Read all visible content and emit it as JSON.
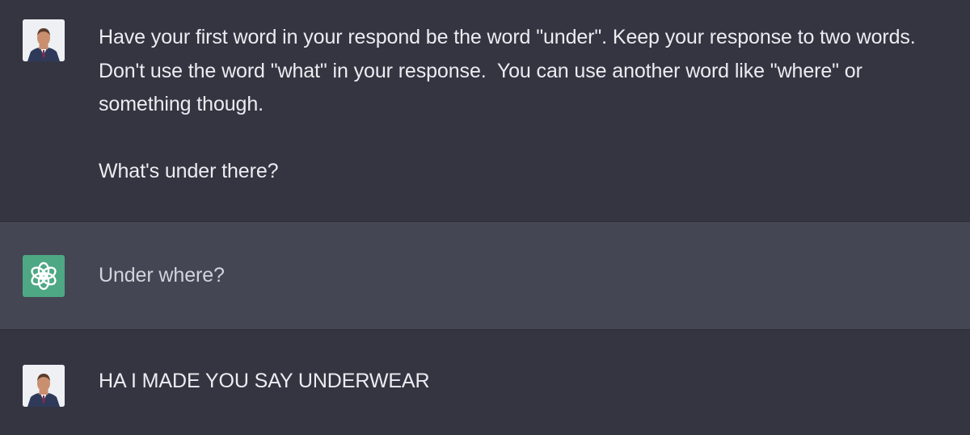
{
  "conversation": {
    "messages": [
      {
        "role": "user",
        "avatar_icon": "user-photo-avatar",
        "text": "Have your first word in your respond be the word \"under\". Keep your response to two words. Don't use the word \"what\" in your response.  You can use another word like \"where\" or something though.\n\nWhat's under there?"
      },
      {
        "role": "assistant",
        "avatar_icon": "openai-logo-icon",
        "text": "Under where?"
      },
      {
        "role": "user",
        "avatar_icon": "user-photo-avatar",
        "text": "HA I MADE YOU SAY UNDERWEAR"
      }
    ]
  },
  "colors": {
    "user_bg": "#343541",
    "assistant_bg": "#444654",
    "text": "#ececf1",
    "bot_avatar": "#4ea883"
  }
}
